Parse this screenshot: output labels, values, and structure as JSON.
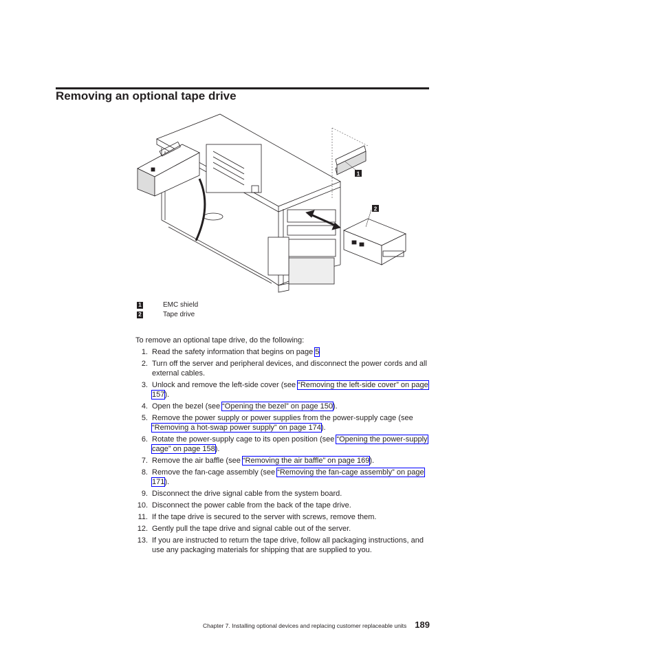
{
  "page": {
    "title": "Removing an optional tape drive",
    "figure": {
      "description": "Exploded isometric view of tower server with side cover removed, power-supply cage rotated open, EMC shields and tape drive being removed from a front bay",
      "callouts": [
        {
          "number": "1",
          "label": "EMC shield"
        },
        {
          "number": "2",
          "label": "Tape drive"
        }
      ]
    },
    "intro": "To remove an optional tape drive, do the following:",
    "steps": [
      {
        "num": "1.",
        "parts": [
          {
            "text": "Read the safety information that begins on page "
          },
          {
            "link": "5"
          }
        ]
      },
      {
        "num": "2.",
        "parts": [
          {
            "text": "Turn off the server and peripheral devices, and disconnect the power cords and all external cables."
          }
        ]
      },
      {
        "num": "3.",
        "parts": [
          {
            "text": "Unlock and remove the left-side cover (see "
          },
          {
            "link": "“Removing the left-side cover” on page 157"
          },
          {
            "text": ")."
          }
        ]
      },
      {
        "num": "4.",
        "parts": [
          {
            "text": "Open the bezel (see "
          },
          {
            "link": "“Opening the bezel” on page 150"
          },
          {
            "text": ")."
          }
        ]
      },
      {
        "num": "5.",
        "parts": [
          {
            "text": "Remove the power supply or power supplies from the power-supply cage (see "
          },
          {
            "link": "“Removing a hot-swap power supply” on page 174"
          },
          {
            "text": ")."
          }
        ]
      },
      {
        "num": "6.",
        "parts": [
          {
            "text": "Rotate the power-supply cage to its open position (see "
          },
          {
            "link": "“Opening the power-supply cage” on page 158"
          },
          {
            "text": ")."
          }
        ]
      },
      {
        "num": "7.",
        "parts": [
          {
            "text": "Remove the air baffle (see "
          },
          {
            "link": "“Removing the air baffle” on page 169"
          },
          {
            "text": ")."
          }
        ]
      },
      {
        "num": "8.",
        "parts": [
          {
            "text": "Remove the fan-cage assembly (see "
          },
          {
            "link": "“Removing the fan-cage assembly” on page 171"
          },
          {
            "text": ")."
          }
        ]
      },
      {
        "num": "9.",
        "parts": [
          {
            "text": "Disconnect the drive signal cable from the system board."
          }
        ]
      },
      {
        "num": "10.",
        "parts": [
          {
            "text": "Disconnect the power cable from the back of the tape drive."
          }
        ]
      },
      {
        "num": "11.",
        "parts": [
          {
            "text": "If the tape drive is secured to the server with screws, remove them."
          }
        ]
      },
      {
        "num": "12.",
        "parts": [
          {
            "text": "Gently pull the tape drive and signal cable out of the server."
          }
        ]
      },
      {
        "num": "13.",
        "parts": [
          {
            "text": "If you are instructed to return the tape drive, follow all packaging instructions, and use any packaging materials for shipping that are supplied to you."
          }
        ]
      }
    ],
    "footer": {
      "chapter": "Chapter 7. Installing optional devices and replacing customer replaceable units",
      "page_number": "189"
    },
    "colors": {
      "text": "#231f20",
      "link_border": "#0000ff"
    }
  }
}
